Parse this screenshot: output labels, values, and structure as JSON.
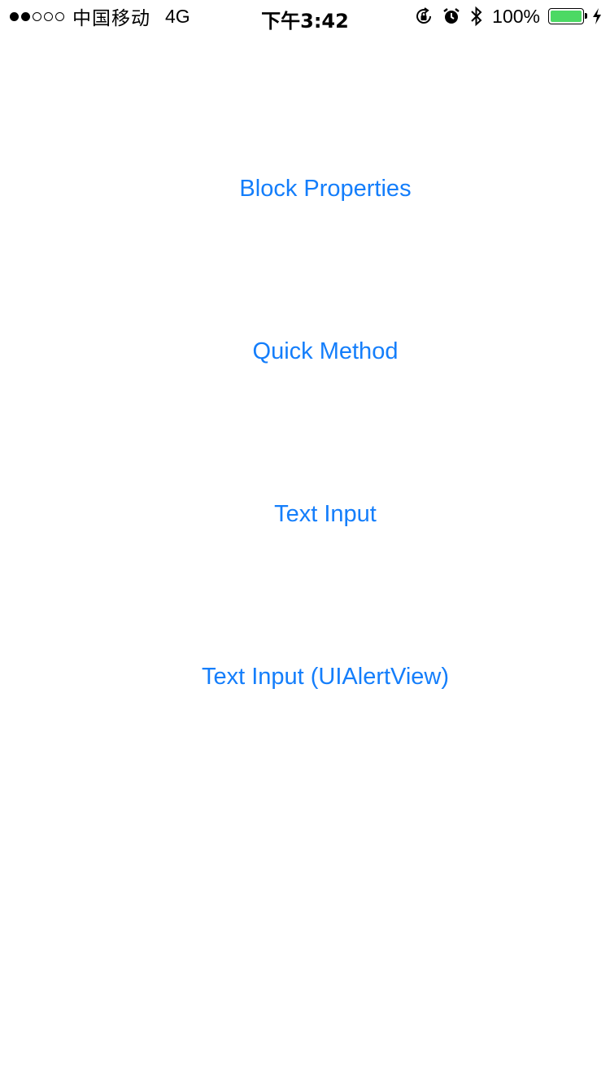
{
  "status_bar": {
    "signal_dots_filled": 2,
    "signal_dots_total": 5,
    "carrier": "中国移动",
    "network": "4G",
    "time": "下午3:42",
    "icons": [
      "orientation-lock-icon",
      "alarm-icon",
      "bluetooth-icon"
    ],
    "battery_percent_label": "100%",
    "battery_level": 1.0,
    "battery_color": "#4cd964",
    "charging": true
  },
  "menu": {
    "accent_color": "#147efb",
    "items": [
      {
        "label": "Block Properties"
      },
      {
        "label": "Quick Method"
      },
      {
        "label": "Text Input"
      },
      {
        "label": "Text Input (UIAlertView)"
      }
    ]
  }
}
